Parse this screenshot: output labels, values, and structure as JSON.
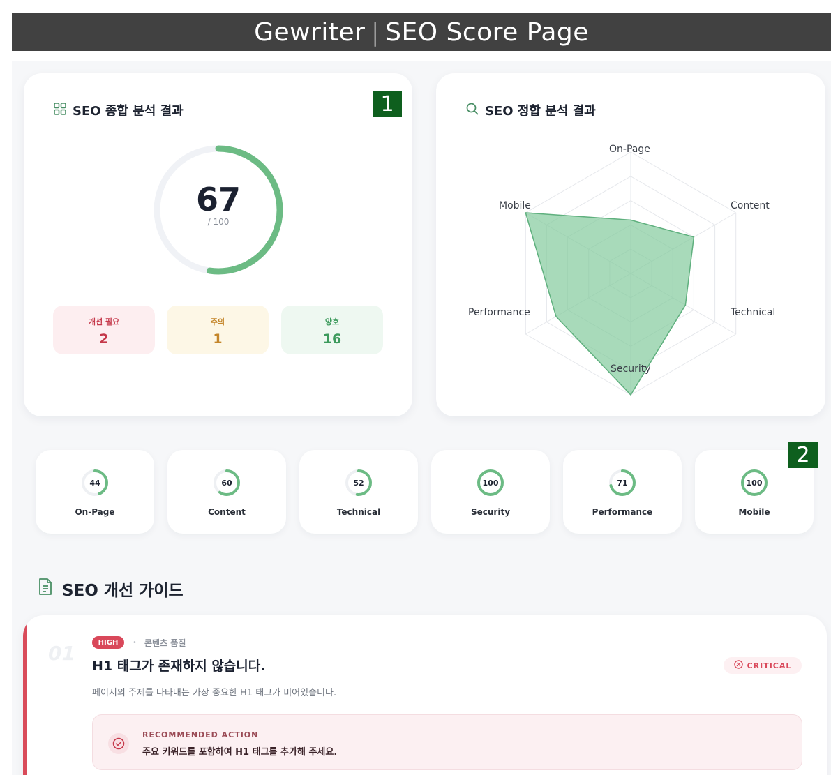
{
  "banner": {
    "app": "Gewriter",
    "separator": "|",
    "page": "SEO Score Page"
  },
  "markers": [
    "1",
    "2"
  ],
  "summary": {
    "title": "SEO 종합 분석 결과",
    "icon": "grid-icon",
    "score": "67",
    "score_max": "/ 100",
    "score_fraction": 0.67,
    "progress_color": "#6cbb84",
    "stats": [
      {
        "label": "개선 필요",
        "value": "2",
        "color": "#c5384a",
        "bg": "#fdeef0"
      },
      {
        "label": "주의",
        "value": "1",
        "color": "#c4862a",
        "bg": "#fdf7e6"
      },
      {
        "label": "양호",
        "value": "16",
        "color": "#3c9a5c",
        "bg": "#eef8f1"
      }
    ]
  },
  "radar": {
    "title": "SEO 정합 분석 결과",
    "icon": "search-icon",
    "axes": [
      "On-Page",
      "Content",
      "Technical",
      "Security",
      "Performance",
      "Mobile"
    ],
    "values": [
      44,
      60,
      52,
      100,
      71,
      100
    ],
    "max": 100,
    "fill_color": "#7fc99a"
  },
  "categories": [
    {
      "label": "On-Page",
      "score": "44",
      "value": 44
    },
    {
      "label": "Content",
      "score": "60",
      "value": 60
    },
    {
      "label": "Technical",
      "score": "52",
      "value": 52
    },
    {
      "label": "Security",
      "score": "100",
      "value": 100
    },
    {
      "label": "Performance",
      "score": "71",
      "value": 71
    },
    {
      "label": "Mobile",
      "score": "100",
      "value": 100
    }
  ],
  "guide": {
    "title": "SEO 개선 가이드",
    "icon": "document-icon",
    "issue": {
      "number": "01",
      "priority": "HIGH",
      "category": "콘텐츠 품질",
      "headline": "H1 태그가 존재하지 않습니다.",
      "description": "페이지의 주제를 나타내는 가장 중요한 H1 태그가 비어있습니다.",
      "severity": "CRITICAL",
      "action_label": "RECOMMENDED ACTION",
      "action_text": "주요 키워드를 포함하여 H1 태그를 추가해 주세요."
    }
  }
}
